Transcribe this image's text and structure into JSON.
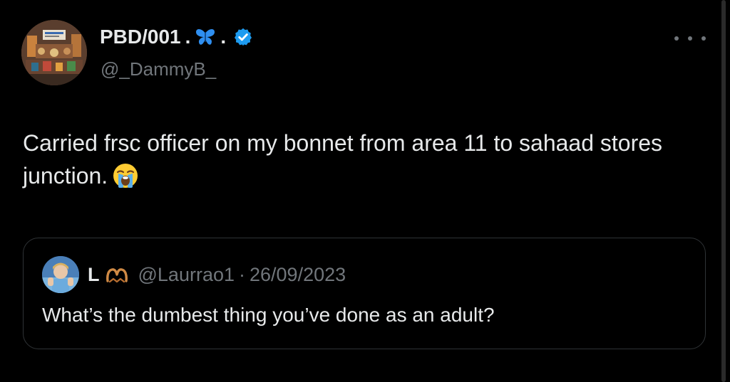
{
  "author": {
    "name": "PBD/001",
    "name_sep_1": ".",
    "name_emoji_icon": "blue-butterfly-icon",
    "name_sep_2": ".",
    "verified_icon": "verified-badge-icon",
    "handle": "@_DammyB_"
  },
  "more_icon": "more-horizontal-icon",
  "tweet": {
    "text": "Carried frsc officer on my bonnet from area 11 to sahaad stores junction.",
    "emoji_icon": "loudly-crying-face-icon"
  },
  "quoted": {
    "name": "L",
    "name_emoji_icon": "heart-hands-icon",
    "handle": "@Laurrao1",
    "separator": "·",
    "date": "26/09/2023",
    "text": "What’s the dumbest thing you’ve done as an adult?"
  },
  "colors": {
    "background": "#000000",
    "primary_text": "#e7e9ea",
    "secondary_text": "#71767b",
    "verified_blue": "#1d9bf0",
    "border": "#2f3336"
  }
}
